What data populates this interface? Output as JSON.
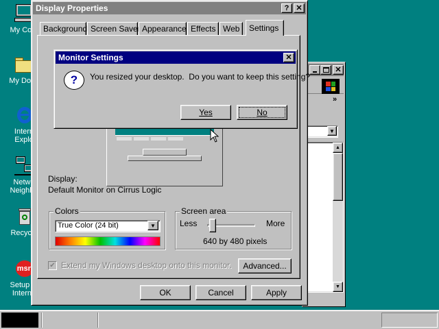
{
  "desktop": {
    "icons": [
      {
        "label": "My Com",
        "icon": "computer-icon"
      },
      {
        "label": "My Docu",
        "icon": "folder-icon"
      },
      {
        "label": "Intern",
        "label2": "Explo",
        "icon": "internet-explorer-icon"
      },
      {
        "label": "Netwo",
        "label2": "Neighbo",
        "icon": "network-icon"
      },
      {
        "label": "Recycle",
        "icon": "recycle-bin-icon"
      },
      {
        "label": "Setup M",
        "label2": "Interne",
        "icon": "msn-icon"
      }
    ]
  },
  "display_properties": {
    "title": "Display Properties",
    "tabs": [
      "Background",
      "Screen Saver",
      "Appearance",
      "Effects",
      "Web",
      "Settings"
    ],
    "active_tab": "Settings",
    "display_label": "Display:",
    "display_value": "Default Monitor on Cirrus Logic",
    "colors": {
      "label": "Colors",
      "selected": "True Color (24 bit)"
    },
    "screen_area": {
      "label": "Screen area",
      "less": "Less",
      "more": "More",
      "value_text": "640 by 480 pixels",
      "slider_fraction": 0.05
    },
    "extend_checkbox": {
      "label": "Extend my Windows desktop onto this monitor.",
      "checked": true,
      "disabled": true
    },
    "advanced_label": "Advanced...",
    "ok_label": "OK",
    "cancel_label": "Cancel",
    "apply_label": "Apply"
  },
  "monitor_settings": {
    "title": "Monitor Settings",
    "message": "You resized your desktop.  Do you want to keep this setting?",
    "yes_label": "Yes",
    "no_label": "No"
  },
  "colors": {
    "desktop": "#008080",
    "titlebar_active": "#000080",
    "titlebar_inactive": "#808080",
    "face": "#c0c0c0"
  }
}
